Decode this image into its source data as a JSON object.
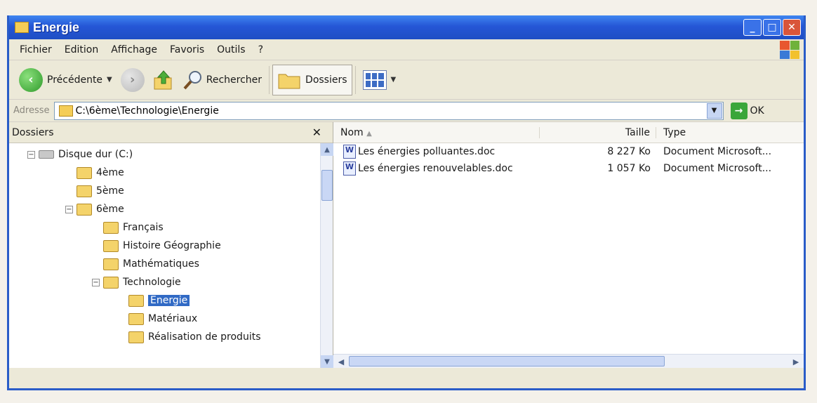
{
  "window": {
    "title": "Energie"
  },
  "menu": [
    "Fichier",
    "Edition",
    "Affichage",
    "Favoris",
    "Outils",
    "?"
  ],
  "toolbar": {
    "back": "Précédente",
    "search": "Rechercher",
    "folders": "Dossiers"
  },
  "address": {
    "label": "Adresse",
    "value": "C:\\6ème\\Technologie\\Energie",
    "go": "OK"
  },
  "folder_pane": {
    "title": "Dossiers",
    "tree": [
      {
        "label": "Disque dur (C:)",
        "type": "drive"
      },
      {
        "label": "4ème"
      },
      {
        "label": "5ème"
      },
      {
        "label": "6ème"
      },
      {
        "label": "Français"
      },
      {
        "label": "Histoire Géographie"
      },
      {
        "label": "Mathématiques"
      },
      {
        "label": "Technologie"
      },
      {
        "label": "Energie",
        "selected": true
      },
      {
        "label": "Matériaux"
      },
      {
        "label": "Réalisation de produits"
      }
    ]
  },
  "file_list": {
    "columns": {
      "name": "Nom",
      "size": "Taille",
      "type": "Type"
    },
    "files": [
      {
        "name": "Les énergies polluantes.doc",
        "size": "8 227 Ko",
        "type": "Document Microsoft..."
      },
      {
        "name": "Les énergies renouvelables.doc",
        "size": "1 057 Ko",
        "type": "Document Microsoft..."
      }
    ]
  },
  "colors": {
    "titlebar": "#2556d6",
    "selection": "#316ac5",
    "folder": "#f4d36a"
  }
}
